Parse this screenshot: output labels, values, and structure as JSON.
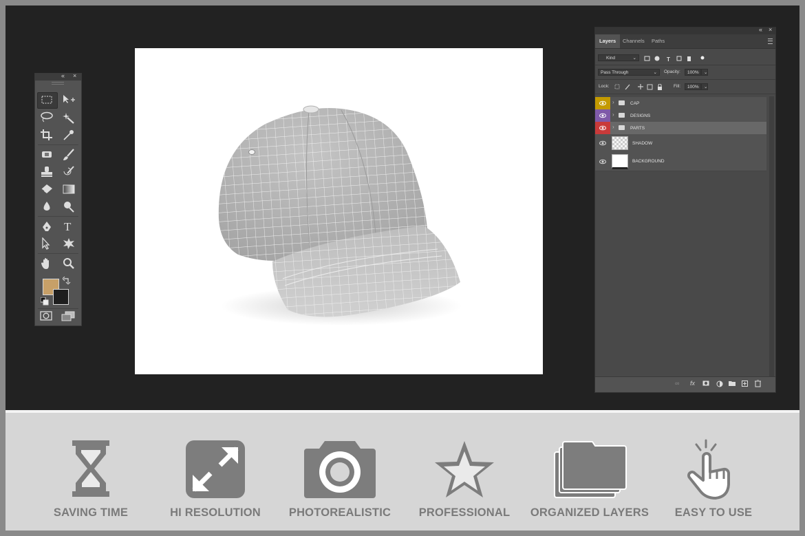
{
  "layers_panel": {
    "tabs": [
      "Layers",
      "Channels",
      "Paths"
    ],
    "filter_kind": "Kind",
    "blend_mode": "Pass Through",
    "opacity_label": "Opacity:",
    "opacity_value": "100%",
    "lock_label": "Lock:",
    "fill_label": "Fill:",
    "fill_value": "100%",
    "layers": [
      {
        "name": "CAP",
        "type": "group",
        "color": "#c49a00"
      },
      {
        "name": "DESIGNS",
        "type": "group",
        "color": "#7f5aa8"
      },
      {
        "name": "PARTS",
        "type": "group",
        "color": "#c93a3a"
      },
      {
        "name": "SHADOW",
        "type": "layer"
      },
      {
        "name": "BACKGROUND",
        "type": "layer"
      }
    ]
  },
  "tools_panel": {
    "tools": [
      "marquee-tool",
      "move-tool",
      "lasso-tool",
      "magic-wand-tool",
      "crop-tool",
      "eyedropper-tool",
      "healing-brush-tool",
      "brush-tool",
      "clone-stamp-tool",
      "history-brush-tool",
      "eraser-tool",
      "gradient-tool",
      "blur-tool",
      "dodge-tool",
      "pen-tool",
      "type-tool",
      "path-selection-tool",
      "shape-tool",
      "hand-tool",
      "zoom-tool"
    ],
    "foreground_color": "#c7a068",
    "background_color": "#1e1e1e"
  },
  "features": [
    {
      "label": "SAVING TIME",
      "icon": "hourglass-icon"
    },
    {
      "label": "HI RESOLUTION",
      "icon": "expand-arrows-icon"
    },
    {
      "label": "PHOTOREALISTIC",
      "icon": "camera-icon"
    },
    {
      "label": "PROFESSIONAL",
      "icon": "star-icon"
    },
    {
      "label": "ORGANIZED LAYERS",
      "icon": "stacked-folders-icon"
    },
    {
      "label": "EASY TO USE",
      "icon": "tap-hand-icon"
    }
  ]
}
